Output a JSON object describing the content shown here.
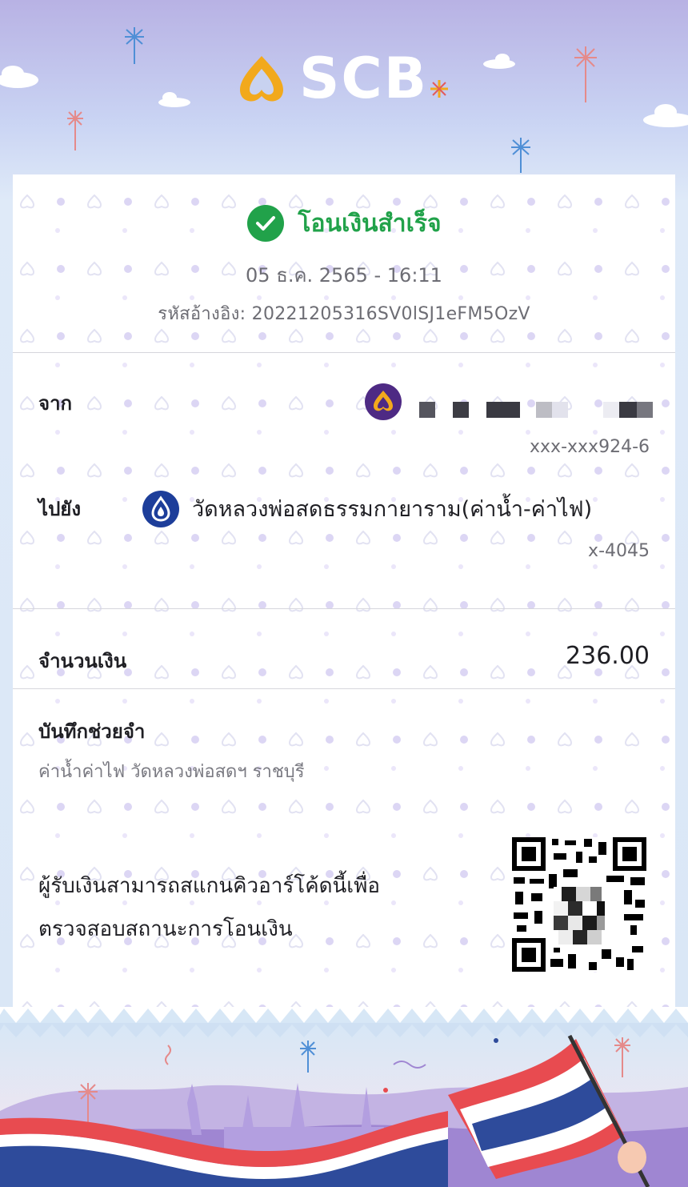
{
  "brand": {
    "name": "SCB",
    "logo_icon": "scb-logo-icon",
    "primary_color": "#4e2a84",
    "accent_gold": "#f2a91c"
  },
  "status": {
    "text": "โอนเงินสำเร็จ",
    "icon": "check-circle-icon",
    "color": "#21a24a"
  },
  "datetime": "05 ธ.ค. 2565 - 16:11",
  "reference": {
    "label": "รหัสอ้างอิง:",
    "value": "20221205316SV0lSJ1eFM5OzV"
  },
  "from": {
    "label": "จาก",
    "bank_icon": "scb-bank-icon",
    "account": "xxx-xxx924-6"
  },
  "to": {
    "label": "ไปยัง",
    "bank_icon": "bbl-bank-icon",
    "name": "วัดหลวงพ่อสดธรรมกายาราม(ค่าน้ำ-ค่าไฟ)",
    "account": "x-4045"
  },
  "amount": {
    "label": "จำนวนเงิน",
    "value": "236.00"
  },
  "memo": {
    "label": "บันทึกช่วยจำ",
    "text": "ค่าน้ำค่าไฟ วัดหลวงพ่อสดฯ ราชบุรี"
  },
  "qr_message": {
    "line1": "ผู้รับเงินสามารถสแกนคิวอาร์โค้ดนี้เพื่อ",
    "line2": "ตรวจสอบสถานะการโอนเงิน",
    "icon": "qr-code-icon"
  }
}
